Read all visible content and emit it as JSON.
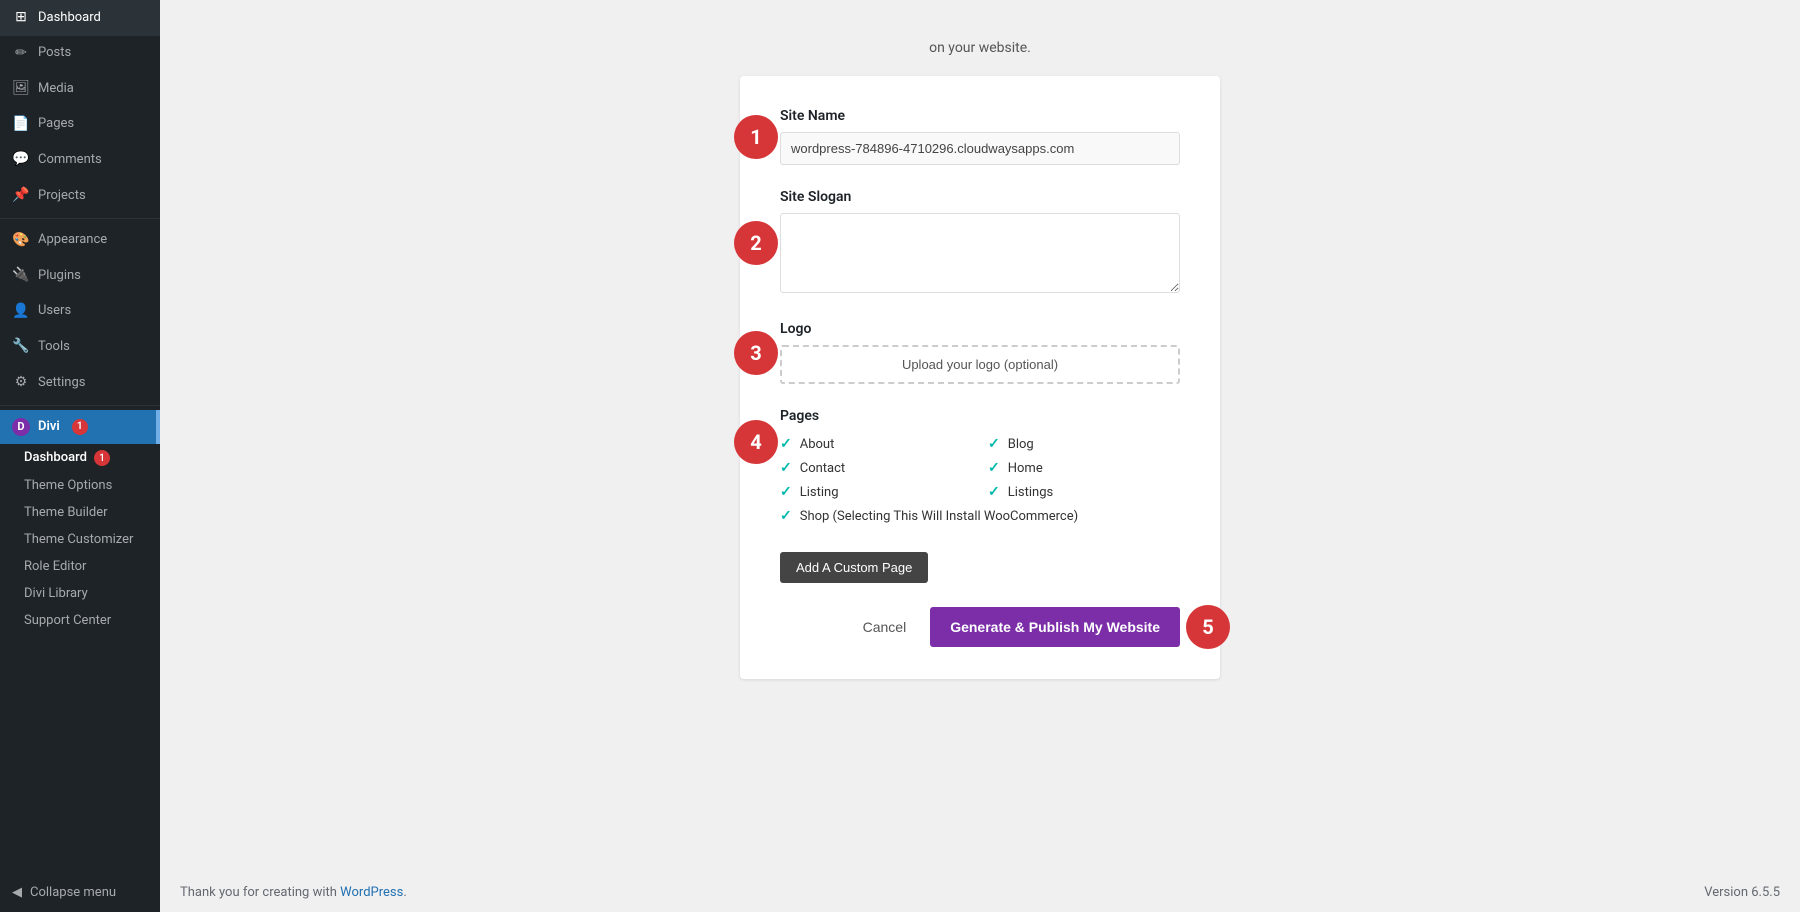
{
  "sidebar": {
    "items": [
      {
        "id": "dashboard",
        "label": "Dashboard",
        "icon": "⊞"
      },
      {
        "id": "posts",
        "label": "Posts",
        "icon": "✏"
      },
      {
        "id": "media",
        "label": "Media",
        "icon": "🖼"
      },
      {
        "id": "pages",
        "label": "Pages",
        "icon": "📄"
      },
      {
        "id": "comments",
        "label": "Comments",
        "icon": "💬"
      },
      {
        "id": "projects",
        "label": "Projects",
        "icon": "📌"
      },
      {
        "id": "appearance",
        "label": "Appearance",
        "icon": "🎨"
      },
      {
        "id": "plugins",
        "label": "Plugins",
        "icon": "🔌"
      },
      {
        "id": "users",
        "label": "Users",
        "icon": "👤"
      },
      {
        "id": "tools",
        "label": "Tools",
        "icon": "🔧"
      },
      {
        "id": "settings",
        "label": "Settings",
        "icon": "⚙"
      }
    ],
    "divi": {
      "header": "Divi",
      "badge": "1",
      "submenu": [
        {
          "id": "divi-dashboard",
          "label": "Dashboard",
          "badge": "1",
          "active": true
        },
        {
          "id": "theme-options",
          "label": "Theme Options"
        },
        {
          "id": "theme-builder",
          "label": "Theme Builder"
        },
        {
          "id": "theme-customizer",
          "label": "Theme Customizer"
        },
        {
          "id": "role-editor",
          "label": "Role Editor"
        },
        {
          "id": "divi-library",
          "label": "Divi Library"
        },
        {
          "id": "support-center",
          "label": "Support Center"
        }
      ]
    },
    "collapse": "Collapse menu"
  },
  "main": {
    "top_text": "on your website.",
    "steps": [
      {
        "number": "1",
        "label": "Site Name",
        "input_value": "wordpress-784896-4710296.cloudwaysapps.com",
        "input_placeholder": ""
      },
      {
        "number": "2",
        "label": "Site Slogan",
        "input_value": "",
        "input_placeholder": ""
      },
      {
        "number": "3",
        "label": "Logo",
        "upload_label": "Upload your logo (optional)"
      },
      {
        "number": "4",
        "label": "Pages"
      },
      {
        "number": "5"
      }
    ],
    "pages": {
      "label": "Pages",
      "items": [
        {
          "id": "about",
          "label": "About",
          "checked": true
        },
        {
          "id": "blog",
          "label": "Blog",
          "checked": true
        },
        {
          "id": "contact",
          "label": "Contact",
          "checked": true
        },
        {
          "id": "home",
          "label": "Home",
          "checked": true
        },
        {
          "id": "listing",
          "label": "Listing",
          "checked": true
        },
        {
          "id": "listings",
          "label": "Listings",
          "checked": true
        },
        {
          "id": "shop",
          "label": "Shop (Selecting This Will Install WooCommerce)",
          "checked": true,
          "full_row": true
        }
      ]
    },
    "add_custom_page_label": "Add A Custom Page",
    "cancel_label": "Cancel",
    "generate_label": "Generate & Publish My Website"
  },
  "footer": {
    "text_before_link": "Thank you for creating with ",
    "link_text": "WordPress",
    "text_after_link": ".",
    "version": "Version 6.5.5"
  }
}
